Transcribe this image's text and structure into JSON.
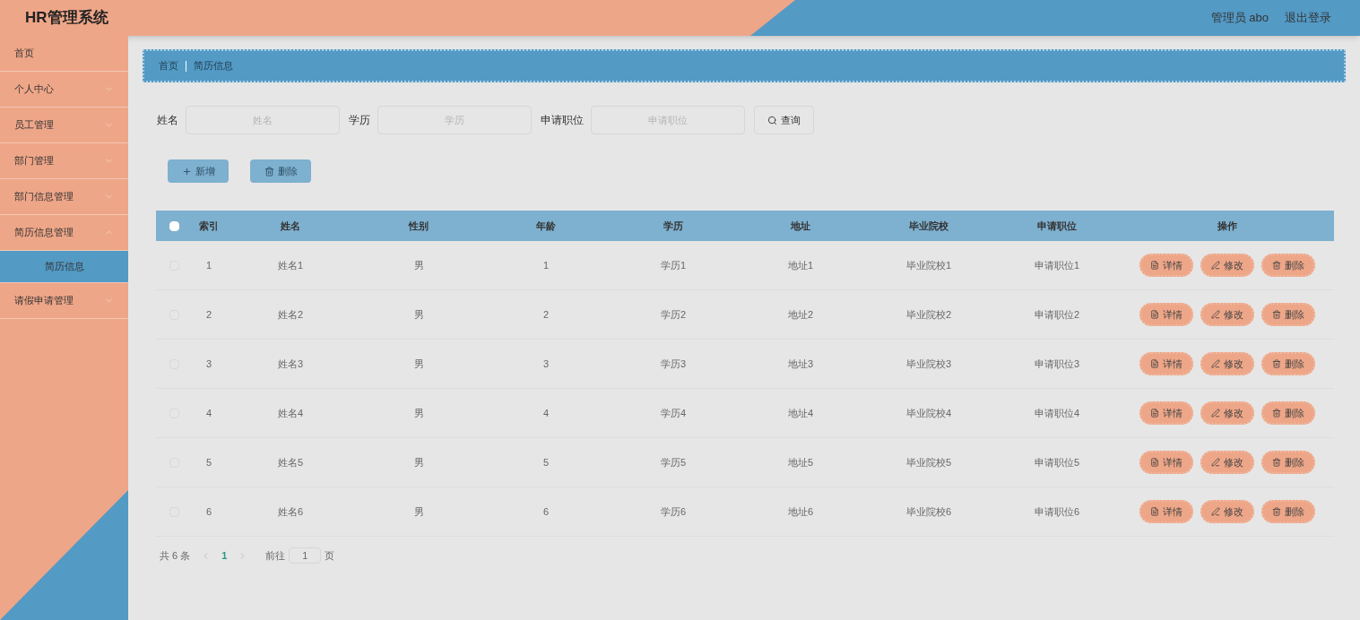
{
  "header": {
    "title": "HR管理系统",
    "user": "管理员 abo",
    "logout": "退出登录"
  },
  "sidebar": {
    "items": [
      {
        "label": "首页",
        "has_arrow": false
      },
      {
        "label": "个人中心",
        "expanded": false,
        "has_arrow": true
      },
      {
        "label": "员工管理",
        "expanded": false,
        "has_arrow": true
      },
      {
        "label": "部门管理",
        "expanded": false,
        "has_arrow": true
      },
      {
        "label": "部门信息管理",
        "expanded": false,
        "has_arrow": true
      },
      {
        "label": "简历信息管理",
        "expanded": true,
        "has_arrow": true,
        "children": [
          {
            "label": "简历信息",
            "selected": true
          }
        ]
      },
      {
        "label": "请假申请管理",
        "expanded": false,
        "has_arrow": true
      }
    ]
  },
  "breadcrumb": [
    "首页",
    "简历信息"
  ],
  "search": {
    "fields": [
      {
        "label": "姓名",
        "placeholder": "姓名"
      },
      {
        "label": "学历",
        "placeholder": "学历"
      },
      {
        "label": "申请职位",
        "placeholder": "申请职位"
      }
    ],
    "button": "查询"
  },
  "actions": [
    "新增",
    "删除"
  ],
  "table": {
    "header_checked": false,
    "columns": [
      "索引",
      "姓名",
      "性别",
      "年龄",
      "学历",
      "地址",
      "毕业院校",
      "申请职位",
      "操作"
    ],
    "rows": [
      {
        "checked": false,
        "cells": [
          "1",
          "姓名1",
          "男",
          "1",
          "学历1",
          "地址1",
          "毕业院校1",
          "申请职位1"
        ],
        "actions": [
          {
            "kind": "detail",
            "label": "详情"
          },
          {
            "kind": "edit",
            "label": "修改"
          },
          {
            "kind": "delete",
            "label": "删除"
          }
        ]
      },
      {
        "checked": false,
        "cells": [
          "2",
          "姓名2",
          "男",
          "2",
          "学历2",
          "地址2",
          "毕业院校2",
          "申请职位2"
        ],
        "actions": [
          {
            "kind": "detail",
            "label": "详情"
          },
          {
            "kind": "edit",
            "label": "修改"
          },
          {
            "kind": "delete",
            "label": "删除"
          }
        ]
      },
      {
        "checked": false,
        "cells": [
          "3",
          "姓名3",
          "男",
          "3",
          "学历3",
          "地址3",
          "毕业院校3",
          "申请职位3"
        ],
        "actions": [
          {
            "kind": "detail",
            "label": "详情"
          },
          {
            "kind": "edit",
            "label": "修改"
          },
          {
            "kind": "delete",
            "label": "删除"
          }
        ]
      },
      {
        "checked": false,
        "cells": [
          "4",
          "姓名4",
          "男",
          "4",
          "学历4",
          "地址4",
          "毕业院校4",
          "申请职位4"
        ],
        "actions": [
          {
            "kind": "detail",
            "label": "详情"
          },
          {
            "kind": "edit",
            "label": "修改"
          },
          {
            "kind": "delete",
            "label": "删除"
          }
        ]
      },
      {
        "checked": false,
        "cells": [
          "5",
          "姓名5",
          "男",
          "5",
          "学历5",
          "地址5",
          "毕业院校5",
          "申请职位5"
        ],
        "actions": [
          {
            "kind": "detail",
            "label": "详情"
          },
          {
            "kind": "edit",
            "label": "修改"
          },
          {
            "kind": "delete",
            "label": "删除"
          }
        ]
      },
      {
        "checked": false,
        "cells": [
          "6",
          "姓名6",
          "男",
          "6",
          "学历6",
          "地址6",
          "毕业院校6",
          "申请职位6"
        ],
        "actions": [
          {
            "kind": "detail",
            "label": "详情"
          },
          {
            "kind": "edit",
            "label": "修改"
          },
          {
            "kind": "delete",
            "label": "删除"
          }
        ]
      }
    ]
  },
  "pagination": {
    "total": "共 6 条",
    "pages": [
      {
        "label": "1",
        "selected": true
      }
    ],
    "goto": "前往",
    "page_value": "1",
    "page_suffix": "页"
  }
}
